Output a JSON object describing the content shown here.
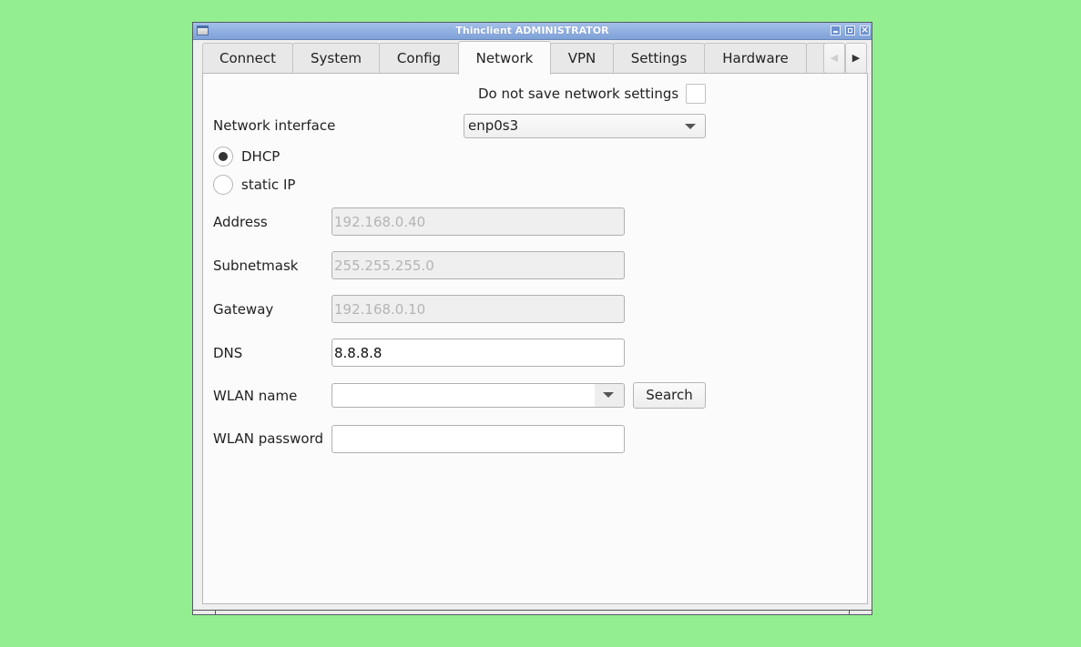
{
  "window": {
    "title": "Thinclient ADMINISTRATOR",
    "controls": [
      "minimize",
      "maximize",
      "close"
    ]
  },
  "tabs": [
    {
      "label": "Connect",
      "active": false
    },
    {
      "label": "System",
      "active": false
    },
    {
      "label": "Config",
      "active": false
    },
    {
      "label": "Network",
      "active": true
    },
    {
      "label": "VPN",
      "active": false
    },
    {
      "label": "Settings",
      "active": false
    },
    {
      "label": "Hardware",
      "active": false
    }
  ],
  "tab_scroll": {
    "left_icon": "triangle-left",
    "right_icon": "triangle-right"
  },
  "network": {
    "do_not_save_label": "Do not save network settings",
    "do_not_save_checked": false,
    "interface_label": "Network interface",
    "interface_value": "enp0s3",
    "mode_options": [
      {
        "label": "DHCP",
        "selected": true
      },
      {
        "label": "static IP",
        "selected": false
      }
    ],
    "fields": {
      "address": {
        "label": "Address",
        "value": "192.168.0.40",
        "disabled": true
      },
      "subnetmask": {
        "label": "Subnetmask",
        "value": "255.255.255.0",
        "disabled": true
      },
      "gateway": {
        "label": "Gateway",
        "value": "192.168.0.10",
        "disabled": true
      },
      "dns": {
        "label": "DNS",
        "value": "8.8.8.8",
        "disabled": false
      }
    },
    "wlan_name_label": "WLAN name",
    "wlan_name_value": "",
    "search_button": "Search",
    "wlan_password_label": "WLAN password",
    "wlan_password_value": ""
  }
}
